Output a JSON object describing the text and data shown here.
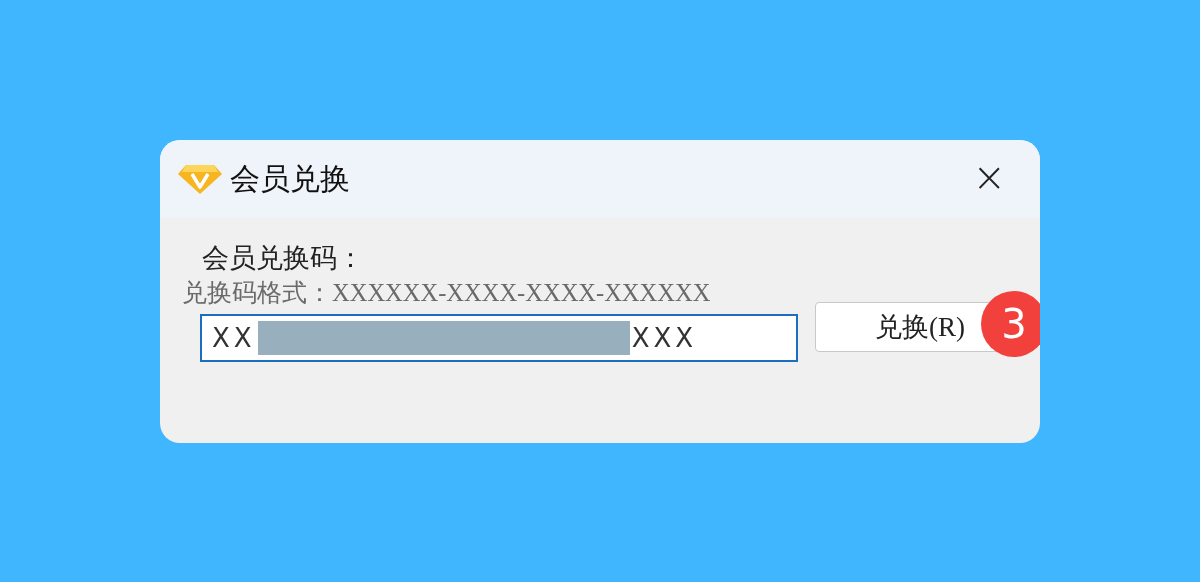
{
  "window": {
    "title": "会员兑换",
    "close_label": "×"
  },
  "form": {
    "label": "会员兑换码：",
    "format_hint": "兑换码格式：XXXXXX-XXXX-XXXX-XXXXXX",
    "field": {
      "value_prefix": "XX",
      "value_suffix": "XXX",
      "masked": true,
      "focused": true
    },
    "button": {
      "label": "兑换(R)"
    },
    "badge": "3"
  }
}
